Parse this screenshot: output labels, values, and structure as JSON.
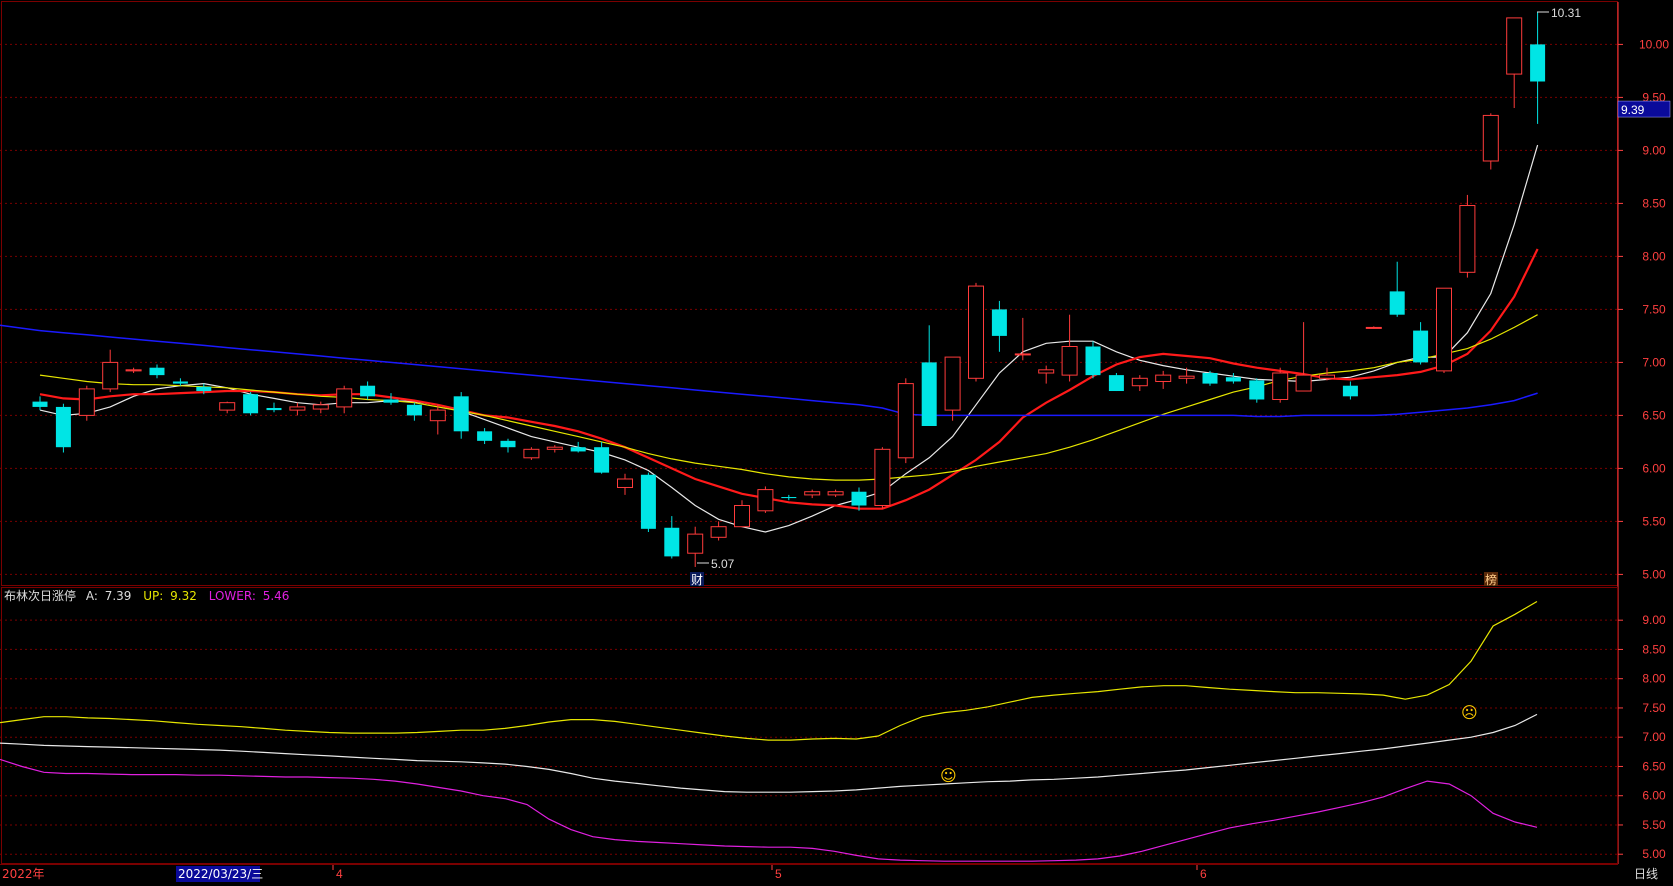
{
  "indicator": {
    "name": "布林次日涨停",
    "a_label": "A:",
    "a_value": "7.39",
    "up_label": "UP:",
    "up_value": "9.32",
    "lower_label": "LOWER:",
    "lower_value": "5.46"
  },
  "price_tag": "9.39",
  "price_tag_value": 9.39,
  "markers": {
    "high_label": "10.31",
    "low_label": "5.07",
    "cai_badge": "财",
    "bang_badge": "榜",
    "smile_icon": "☺",
    "frown_icon": "☹"
  },
  "time_axis": {
    "labels": [
      "2022年",
      "2022/03/23/三",
      "4",
      "5",
      "6"
    ],
    "mode": "日线"
  },
  "colors": {
    "up": "#ff3b3b",
    "down": "#00e5e5",
    "ma5": "#e8e8e8",
    "ma10": "#ff1a1a",
    "ma20": "#e6e600",
    "ma60": "#1a1aff",
    "boll_up": "#e6e600",
    "boll_mid": "#e8e8e8",
    "boll_low": "#e020e0",
    "grid": "#7a0000",
    "axis_text": "#ff4040"
  },
  "chart_data": [
    {
      "type": "candlestick",
      "ylim": [
        4.9,
        10.4
      ],
      "yticks": [
        "10.00",
        "9.50",
        "9.00",
        "8.50",
        "8.00",
        "7.50",
        "7.00",
        "6.50",
        "6.00",
        "5.50",
        "5.00"
      ],
      "candles": [
        [
          6.63,
          6.68,
          6.55,
          6.58
        ],
        [
          6.58,
          6.61,
          6.15,
          6.2
        ],
        [
          6.5,
          6.78,
          6.45,
          6.75
        ],
        [
          6.75,
          7.12,
          6.72,
          7.0
        ],
        [
          6.92,
          6.95,
          6.9,
          6.93
        ],
        [
          6.95,
          6.98,
          6.85,
          6.88
        ],
        [
          6.82,
          6.85,
          6.78,
          6.8
        ],
        [
          6.77,
          6.8,
          6.7,
          6.73
        ],
        [
          6.55,
          6.63,
          6.52,
          6.62
        ],
        [
          6.7,
          6.72,
          6.5,
          6.52
        ],
        [
          6.57,
          6.62,
          6.53,
          6.55
        ],
        [
          6.55,
          6.62,
          6.5,
          6.58
        ],
        [
          6.56,
          6.63,
          6.52,
          6.6
        ],
        [
          6.58,
          6.78,
          6.52,
          6.75
        ],
        [
          6.78,
          6.82,
          6.65,
          6.68
        ],
        [
          6.65,
          6.71,
          6.6,
          6.62
        ],
        [
          6.6,
          6.62,
          6.45,
          6.5
        ],
        [
          6.45,
          6.6,
          6.32,
          6.55
        ],
        [
          6.68,
          6.72,
          6.28,
          6.35
        ],
        [
          6.35,
          6.38,
          6.23,
          6.26
        ],
        [
          6.26,
          6.28,
          6.15,
          6.2
        ],
        [
          6.1,
          6.2,
          6.08,
          6.18
        ],
        [
          6.18,
          6.22,
          6.15,
          6.2
        ],
        [
          6.2,
          6.25,
          6.15,
          6.16
        ],
        [
          6.2,
          6.25,
          5.95,
          5.96
        ],
        [
          5.82,
          5.95,
          5.75,
          5.9
        ],
        [
          5.94,
          5.96,
          5.4,
          5.43
        ],
        [
          5.44,
          5.55,
          5.15,
          5.17
        ],
        [
          5.2,
          5.45,
          5.07,
          5.38
        ],
        [
          5.35,
          5.5,
          5.32,
          5.45
        ],
        [
          5.45,
          5.7,
          5.45,
          5.65
        ],
        [
          5.6,
          5.83,
          5.58,
          5.8
        ],
        [
          5.73,
          5.75,
          5.7,
          5.72
        ],
        [
          5.75,
          5.8,
          5.72,
          5.78
        ],
        [
          5.75,
          5.8,
          5.73,
          5.78
        ],
        [
          5.78,
          5.82,
          5.6,
          5.65
        ],
        [
          5.65,
          6.2,
          5.62,
          6.18
        ],
        [
          6.1,
          6.85,
          6.05,
          6.8
        ],
        [
          7.0,
          7.35,
          6.4,
          6.4
        ],
        [
          6.55,
          7.05,
          6.45,
          7.05
        ],
        [
          6.85,
          7.75,
          6.82,
          7.72
        ],
        [
          7.5,
          7.58,
          7.1,
          7.25
        ],
        [
          7.08,
          7.42,
          7.02,
          7.08
        ],
        [
          6.9,
          6.97,
          6.8,
          6.93
        ],
        [
          6.88,
          7.45,
          6.82,
          7.15
        ],
        [
          7.15,
          7.2,
          6.85,
          6.88
        ],
        [
          6.88,
          6.9,
          6.73,
          6.73
        ],
        [
          6.78,
          6.88,
          6.73,
          6.85
        ],
        [
          6.82,
          6.92,
          6.75,
          6.88
        ],
        [
          6.85,
          6.95,
          6.8,
          6.87
        ],
        [
          6.9,
          6.92,
          6.78,
          6.8
        ],
        [
          6.86,
          6.9,
          6.8,
          6.82
        ],
        [
          6.83,
          6.85,
          6.62,
          6.65
        ],
        [
          6.65,
          6.95,
          6.62,
          6.9
        ],
        [
          6.73,
          7.38,
          6.73,
          6.88
        ],
        [
          6.85,
          6.95,
          6.83,
          6.88
        ],
        [
          6.78,
          6.82,
          6.65,
          6.68
        ],
        [
          7.33,
          7.34,
          7.32,
          7.33
        ],
        [
          7.67,
          7.95,
          7.43,
          7.45
        ],
        [
          7.3,
          7.38,
          6.98,
          7.0
        ],
        [
          6.92,
          7.7,
          6.9,
          7.7
        ],
        [
          7.85,
          8.58,
          7.8,
          8.48
        ],
        [
          8.9,
          9.35,
          8.82,
          9.33
        ],
        [
          9.72,
          10.25,
          9.4,
          10.25
        ],
        [
          10.0,
          10.31,
          9.25,
          9.65
        ]
      ],
      "series": [
        {
          "name": "MA5",
          "values": [
            6.55,
            6.5,
            6.52,
            6.58,
            6.68,
            6.75,
            6.78,
            6.8,
            6.76,
            6.7,
            6.66,
            6.62,
            6.6,
            6.62,
            6.62,
            6.64,
            6.63,
            6.6,
            6.54,
            6.46,
            6.38,
            6.3,
            6.25,
            6.2,
            6.15,
            6.08,
            5.98,
            5.82,
            5.65,
            5.52,
            5.45,
            5.4,
            5.46,
            5.55,
            5.65,
            5.71,
            5.78,
            5.95,
            6.1,
            6.3,
            6.6,
            6.9,
            7.1,
            7.18,
            7.2,
            7.2,
            7.1,
            7.02,
            6.97,
            6.93,
            6.9,
            6.87,
            6.84,
            6.83,
            6.82,
            6.84,
            6.86,
            6.92,
            7.0,
            7.05,
            7.05,
            7.28,
            7.65,
            8.3,
            9.05
          ]
        },
        {
          "name": "MA10",
          "values": [
            6.7,
            6.66,
            6.65,
            6.68,
            6.7,
            6.7,
            6.71,
            6.72,
            6.73,
            6.73,
            6.72,
            6.7,
            6.69,
            6.7,
            6.7,
            6.67,
            6.64,
            6.6,
            6.55,
            6.5,
            6.48,
            6.44,
            6.4,
            6.35,
            6.28,
            6.2,
            6.1,
            6.0,
            5.9,
            5.83,
            5.76,
            5.72,
            5.68,
            5.66,
            5.65,
            5.62,
            5.62,
            5.7,
            5.8,
            5.94,
            6.08,
            6.25,
            6.48,
            6.62,
            6.74,
            6.87,
            6.98,
            7.05,
            7.08,
            7.06,
            7.04,
            6.99,
            6.95,
            6.92,
            6.89,
            6.85,
            6.84,
            6.86,
            6.88,
            6.91,
            6.97,
            7.08,
            7.3,
            7.62,
            8.07
          ]
        },
        {
          "name": "MA20",
          "values": [
            6.88,
            6.85,
            6.82,
            6.8,
            6.79,
            6.79,
            6.78,
            6.77,
            6.76,
            6.74,
            6.72,
            6.7,
            6.68,
            6.67,
            6.65,
            6.64,
            6.62,
            6.58,
            6.54,
            6.5,
            6.45,
            6.4,
            6.35,
            6.3,
            6.25,
            6.2,
            6.14,
            6.09,
            6.05,
            6.02,
            5.99,
            5.95,
            5.92,
            5.9,
            5.89,
            5.89,
            5.9,
            5.92,
            5.94,
            5.97,
            6.02,
            6.06,
            6.1,
            6.14,
            6.2,
            6.27,
            6.35,
            6.43,
            6.51,
            6.58,
            6.65,
            6.72,
            6.77,
            6.83,
            6.87,
            6.9,
            6.92,
            6.95,
            7.0,
            7.03,
            7.08,
            7.13,
            7.22,
            7.33,
            7.45
          ]
        },
        {
          "name": "MA60",
          "values": [
            7.3,
            7.28,
            7.26,
            7.24,
            7.22,
            7.2,
            7.18,
            7.16,
            7.14,
            7.12,
            7.1,
            7.08,
            7.06,
            7.04,
            7.02,
            7.0,
            6.98,
            6.96,
            6.94,
            6.92,
            6.9,
            6.88,
            6.86,
            6.84,
            6.82,
            6.8,
            6.78,
            6.76,
            6.74,
            6.72,
            6.7,
            6.68,
            6.66,
            6.64,
            6.62,
            6.6,
            6.57,
            6.51,
            6.5,
            6.5,
            6.5,
            6.5,
            6.5,
            6.5,
            6.5,
            6.5,
            6.5,
            6.5,
            6.5,
            6.5,
            6.5,
            6.5,
            6.49,
            6.49,
            6.5,
            6.5,
            6.5,
            6.5,
            6.51,
            6.53,
            6.55,
            6.57,
            6.6,
            6.64,
            6.71
          ]
        }
      ]
    },
    {
      "type": "line",
      "title": "布林次日涨停",
      "ylim": [
        4.85,
        9.55
      ],
      "yticks": [
        "9.00",
        "8.50",
        "8.00",
        "7.50",
        "7.00",
        "6.50",
        "6.00",
        "5.50",
        "5.00"
      ],
      "series": [
        {
          "name": "UP",
          "values": [
            7.25,
            7.3,
            7.35,
            7.35,
            7.33,
            7.32,
            7.3,
            7.28,
            7.25,
            7.22,
            7.2,
            7.18,
            7.15,
            7.12,
            7.1,
            7.08,
            7.07,
            7.07,
            7.07,
            7.08,
            7.1,
            7.12,
            7.12,
            7.15,
            7.2,
            7.26,
            7.3,
            7.3,
            7.27,
            7.22,
            7.17,
            7.12,
            7.07,
            7.02,
            6.98,
            6.95,
            6.95,
            6.97,
            6.98,
            6.97,
            7.02,
            7.2,
            7.35,
            7.42,
            7.46,
            7.52,
            7.6,
            7.68,
            7.72,
            7.75,
            7.78,
            7.82,
            7.86,
            7.88,
            7.88,
            7.85,
            7.82,
            7.8,
            7.78,
            7.76,
            7.76,
            7.75,
            7.74,
            7.72,
            7.65,
            7.72,
            7.9,
            8.3,
            8.9,
            9.1,
            9.32
          ]
        },
        {
          "name": "A",
          "values": [
            6.9,
            6.88,
            6.86,
            6.85,
            6.84,
            6.83,
            6.82,
            6.81,
            6.8,
            6.79,
            6.78,
            6.76,
            6.74,
            6.72,
            6.7,
            6.68,
            6.66,
            6.64,
            6.62,
            6.6,
            6.59,
            6.58,
            6.56,
            6.54,
            6.5,
            6.45,
            6.38,
            6.3,
            6.25,
            6.21,
            6.17,
            6.13,
            6.1,
            6.07,
            6.06,
            6.06,
            6.06,
            6.07,
            6.08,
            6.1,
            6.13,
            6.16,
            6.18,
            6.2,
            6.22,
            6.24,
            6.25,
            6.27,
            6.28,
            6.3,
            6.32,
            6.35,
            6.38,
            6.41,
            6.44,
            6.48,
            6.52,
            6.56,
            6.6,
            6.64,
            6.68,
            6.72,
            6.76,
            6.8,
            6.85,
            6.9,
            6.95,
            7.0,
            7.08,
            7.2,
            7.39
          ]
        },
        {
          "name": "LOWER",
          "values": [
            6.62,
            6.5,
            6.4,
            6.38,
            6.38,
            6.37,
            6.36,
            6.36,
            6.36,
            6.35,
            6.35,
            6.34,
            6.33,
            6.32,
            6.32,
            6.31,
            6.3,
            6.28,
            6.25,
            6.2,
            6.14,
            6.08,
            6.0,
            5.95,
            5.85,
            5.6,
            5.42,
            5.3,
            5.25,
            5.22,
            5.2,
            5.18,
            5.16,
            5.14,
            5.13,
            5.12,
            5.12,
            5.1,
            5.05,
            4.98,
            4.92,
            4.9,
            4.89,
            4.88,
            4.88,
            4.88,
            4.88,
            4.88,
            4.89,
            4.9,
            4.92,
            4.97,
            5.05,
            5.15,
            5.25,
            5.35,
            5.45,
            5.52,
            5.58,
            5.65,
            5.72,
            5.8,
            5.88,
            5.98,
            6.12,
            6.25,
            6.2,
            6.0,
            5.7,
            5.55,
            5.46
          ]
        }
      ]
    }
  ]
}
